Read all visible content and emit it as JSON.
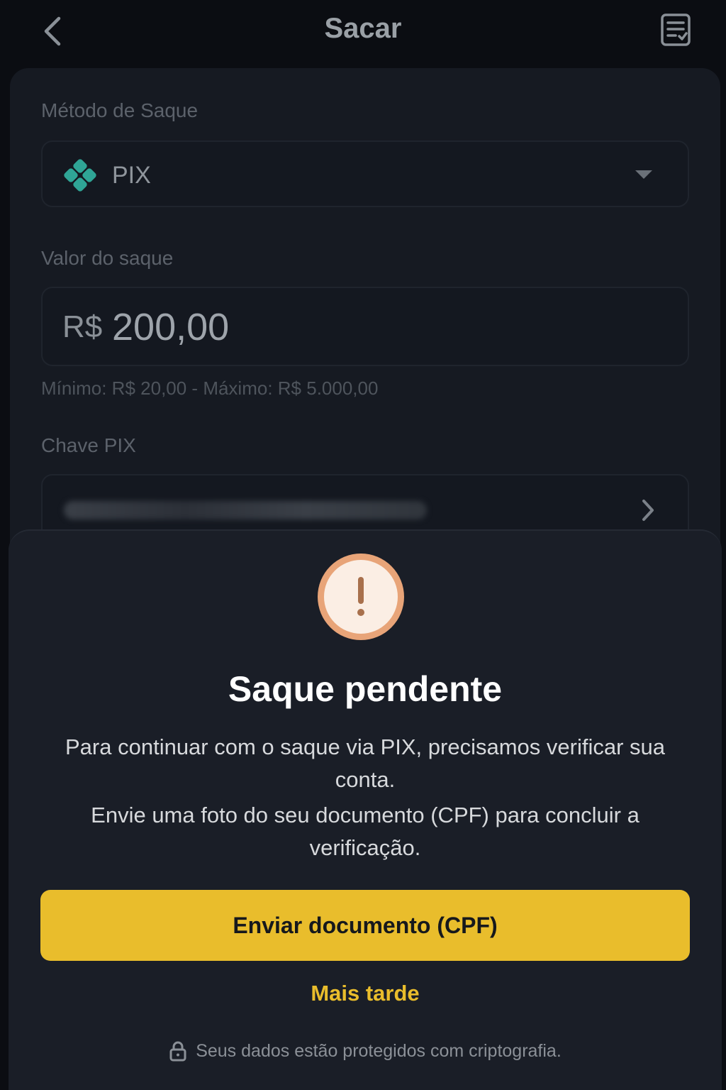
{
  "header": {
    "title": "Sacar",
    "back_icon": "chevron-left-icon",
    "history_icon": "document-list-icon"
  },
  "form": {
    "method_label": "Método de Saque",
    "method_value": "PIX",
    "method_icon": "pix-icon",
    "amount_label": "Valor do saque",
    "currency": "R$",
    "amount": "200,00",
    "limits": "Mínimo: R$ 20,00 - Máximo: R$ 5.000,00",
    "pix_key_label": "Chave PIX"
  },
  "modal": {
    "icon": "exclamation-icon",
    "title": "Saque pendente",
    "message_1": "Para continuar com o saque via PIX, precisamos verificar sua conta.",
    "message_2": "Envie uma foto do seu documento (CPF) para concluir a verificação.",
    "primary_button": "Enviar documento (CPF)",
    "secondary_button": "Mais tarde",
    "security_note": "Seus dados estão protegidos com criptografia.",
    "security_icon": "lock-icon"
  },
  "colors": {
    "accent": "#e9bd2c",
    "background": "#0b0d12",
    "sheet": "#1a1e27",
    "pix_green": "#32bcad",
    "alert_ring": "#e8a478"
  }
}
